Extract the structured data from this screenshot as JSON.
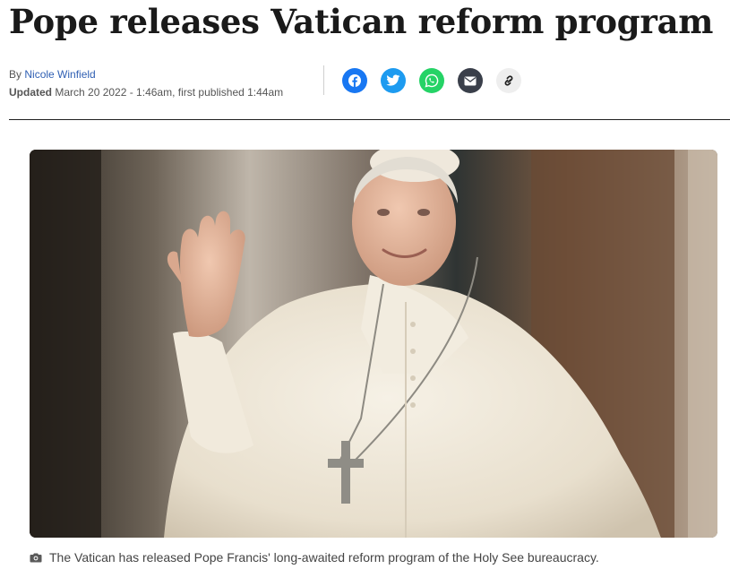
{
  "article": {
    "headline": "Pope releases Vatican reform program",
    "byline_prefix": "By",
    "author": "Nicole Winfield",
    "updated_label": "Updated",
    "updated_text": "March 20 2022 - 1:46am, first published 1:44am"
  },
  "share": {
    "buttons": [
      {
        "icon": "facebook-icon",
        "color": "#1877f2"
      },
      {
        "icon": "twitter-icon",
        "color": "#1d9bf0"
      },
      {
        "icon": "whatsapp-icon",
        "color": "#25d366"
      },
      {
        "icon": "email-icon",
        "color": "#3a3f4a"
      },
      {
        "icon": "link-icon",
        "color": "#eeeeee"
      }
    ]
  },
  "image": {
    "caption": "The Vatican has released Pope Francis' long-awaited reform program of the Holy See bureaucracy.",
    "caption_icon": "camera-icon"
  }
}
